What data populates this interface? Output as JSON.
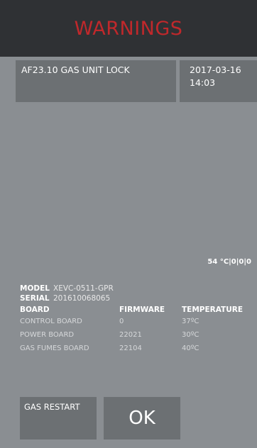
{
  "header": {
    "title": "WARNINGS"
  },
  "warning": {
    "message": "AF23.10 GAS UNIT LOCK",
    "date": "2017-03-16",
    "time": "14:03"
  },
  "temperature_readout": "54 °C|0|0|0",
  "device": {
    "model_label": "MODEL",
    "model_value": "XEVC-0511-GPR",
    "serial_label": "SERIAL",
    "serial_value": "201610068065"
  },
  "boards": {
    "headers": [
      "BOARD",
      "FIRMWARE",
      "TEMPERATURE"
    ],
    "rows": [
      {
        "board": "CONTROL BOARD",
        "firmware": "0",
        "temperature": "37ºC"
      },
      {
        "board": "POWER BOARD",
        "firmware": "22021",
        "temperature": "30ºC"
      },
      {
        "board": "GAS FUMES BOARD",
        "firmware": "22104",
        "temperature": "40ºC"
      }
    ]
  },
  "buttons": {
    "gas_restart": "GAS RESTART",
    "ok": "OK"
  },
  "colors": {
    "background": "#8a8e92",
    "header_bg": "#2f3134",
    "title_red": "#c0282b",
    "panel": "#6c7073"
  }
}
